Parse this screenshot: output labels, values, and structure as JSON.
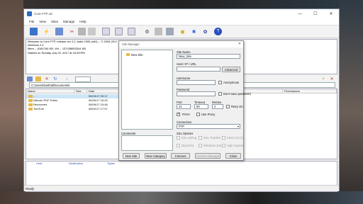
{
  "window": {
    "title": "Core FTP LE",
    "min": "—",
    "max": "☐",
    "close": "✕"
  },
  "menu": [
    "File",
    "View",
    "Sites",
    "Manage",
    "Help"
  ],
  "log_lines": [
    "Welcome to Core FTP, release ver 2.2, build 1905 (x64) -- © 2003-2017",
    "WinSock 2.0",
    "Mem -- 8181784 KB, Virt -- 137438953344 KB",
    "Started on Sunday July 02, 2017 at 16:39:PM"
  ],
  "local": {
    "path": "C:\\Users\\Darthal\\Documents\\",
    "columns": [
      "Name",
      "Size",
      "Date"
    ],
    "rows": [
      {
        "name": "..",
        "date": "06/19/17  20:17"
      },
      {
        "name": "Nitrovin PDF Editor",
        "date": "06/26/17  18:29"
      },
      {
        "name": "Recovered",
        "date": "06/09/17  15:48"
      },
      {
        "name": "TomTom",
        "date": "06/02/17  17:07"
      }
    ]
  },
  "remote": {
    "columns": [
      "Permissions"
    ]
  },
  "queue": {
    "columns": [
      "Host",
      "Destination",
      "Bytes"
    ]
  },
  "status": "Ready",
  "dialog": {
    "title": "Site Manager",
    "close": "✕",
    "tree_item": "New Site",
    "comments_label": "Comments",
    "site_name_label": "Site Name",
    "site_name_value": "New_Site",
    "host_label": "Host / IP / URL",
    "advanced_label": "Advanced",
    "username_label": "Username",
    "anonymous_label": "Anonymous",
    "password_label": "Password",
    "dont_save_password_label": "Don't save password",
    "port_label": "Port",
    "port_value": "21",
    "timeout_label": "Timeout",
    "timeout_value": "60",
    "retries_label": "Retries",
    "retries_value": "2",
    "retry_on_label": "Retry On",
    "pasv_label": "PASV",
    "use_proxy_label": "Use Proxy",
    "connection_label": "Connection",
    "connection_value": "FTP",
    "ssl_label": "SSL Options",
    "ssl_options": [
      "SSL Listing",
      "SSL Transfer",
      "Clear (CCC)",
      "OpenSSL",
      "Windows SSL",
      "High cryptos"
    ],
    "buttons": {
      "new_site": "New Site",
      "new_category": "New Category",
      "connect": "Connect",
      "connect_manage": "Connect Manage",
      "close": "Close"
    }
  }
}
